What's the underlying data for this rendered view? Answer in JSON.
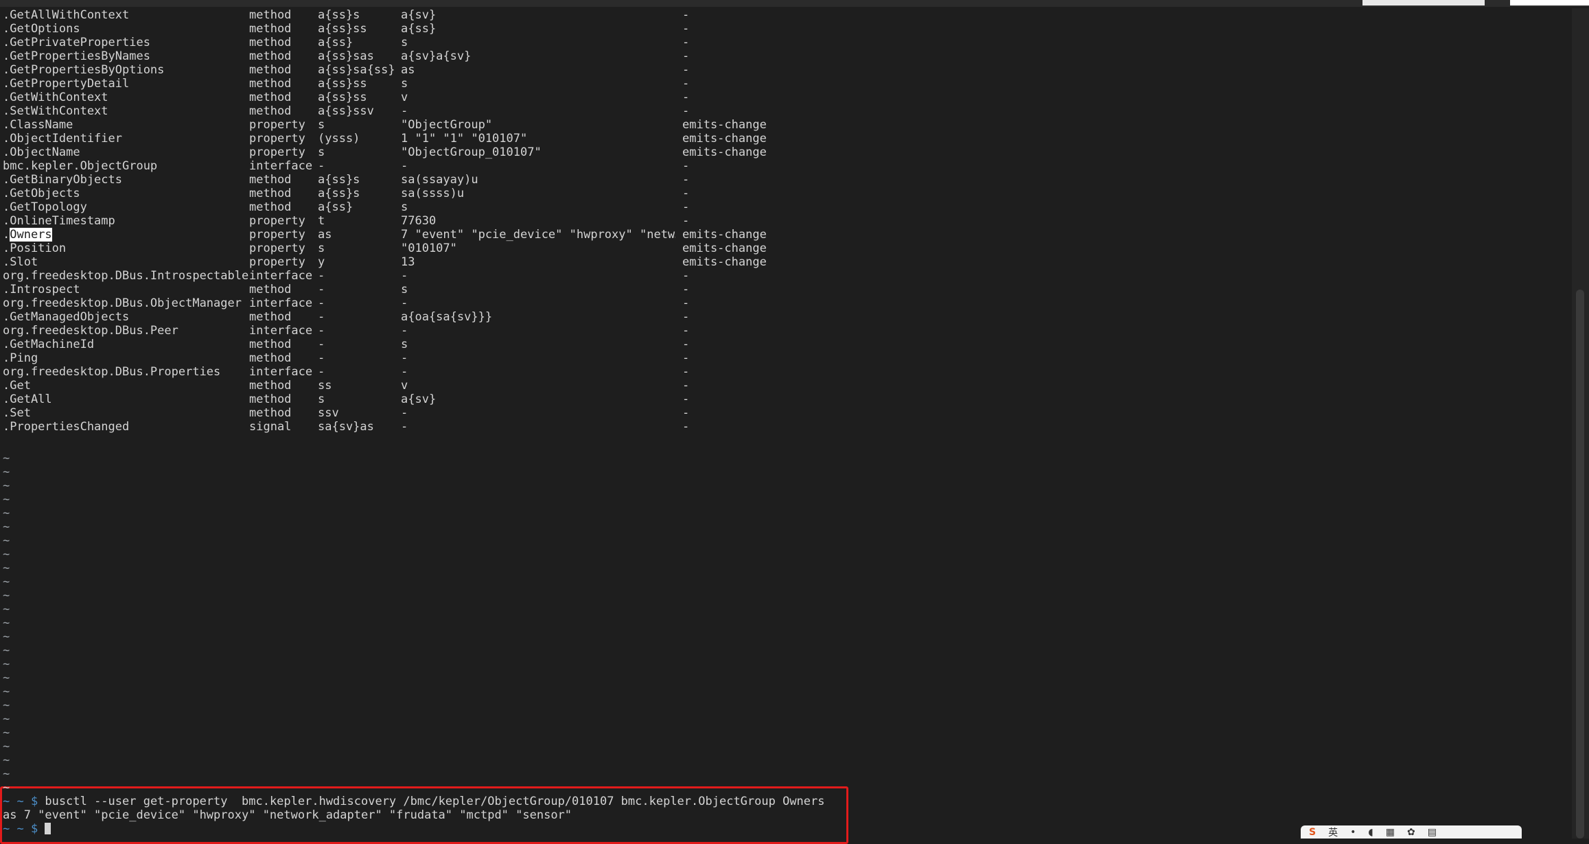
{
  "rows": [
    [
      ".GetAllWithContext",
      "method",
      "a{ss}s",
      "a{sv}",
      "-"
    ],
    [
      ".GetOptions",
      "method",
      "a{ss}ss",
      "a{ss}",
      "-"
    ],
    [
      ".GetPrivateProperties",
      "method",
      "a{ss}",
      "s",
      "-"
    ],
    [
      ".GetPropertiesByNames",
      "method",
      "a{ss}sas",
      "a{sv}a{sv}",
      "-"
    ],
    [
      ".GetPropertiesByOptions",
      "method",
      "a{ss}sa{ss}",
      "as",
      "-"
    ],
    [
      ".GetPropertyDetail",
      "method",
      "a{ss}ss",
      "s",
      "-"
    ],
    [
      ".GetWithContext",
      "method",
      "a{ss}ss",
      "v",
      "-"
    ],
    [
      ".SetWithContext",
      "method",
      "a{ss}ssv",
      "-",
      "-"
    ],
    [
      ".ClassName",
      "property",
      "s",
      "\"ObjectGroup\"",
      "emits-change"
    ],
    [
      ".ObjectIdentifier",
      "property",
      "(ysss)",
      "1 \"1\" \"1\" \"010107\"",
      "emits-change"
    ],
    [
      ".ObjectName",
      "property",
      "s",
      "\"ObjectGroup_010107\"",
      "emits-change"
    ],
    [
      "bmc.kepler.ObjectGroup",
      "interface",
      "-",
      "-",
      "-"
    ],
    [
      ".GetBinaryObjects",
      "method",
      "a{ss}s",
      "sa(ssayay)u",
      "-"
    ],
    [
      ".GetObjects",
      "method",
      "a{ss}s",
      "sa(ssss)u",
      "-"
    ],
    [
      ".GetTopology",
      "method",
      "a{ss}",
      "s",
      "-"
    ],
    [
      ".OnlineTimestamp",
      "property",
      "t",
      "77630",
      "-"
    ],
    [
      ".Owners",
      "property",
      "as",
      "7 \"event\" \"pcie_device\" \"hwproxy\" \"netw…",
      "emits-change"
    ],
    [
      ".Position",
      "property",
      "s",
      "\"010107\"",
      "emits-change"
    ],
    [
      ".Slot",
      "property",
      "y",
      "13",
      "emits-change"
    ],
    [
      "org.freedesktop.DBus.Introspectable",
      "interface",
      "-",
      "-",
      "-"
    ],
    [
      ".Introspect",
      "method",
      "-",
      "s",
      "-"
    ],
    [
      "org.freedesktop.DBus.ObjectManager",
      "interface",
      "-",
      "-",
      "-"
    ],
    [
      ".GetManagedObjects",
      "method",
      "-",
      "a{oa{sa{sv}}}",
      "-"
    ],
    [
      "org.freedesktop.DBus.Peer",
      "interface",
      "-",
      "-",
      "-"
    ],
    [
      ".GetMachineId",
      "method",
      "-",
      "s",
      "-"
    ],
    [
      ".Ping",
      "method",
      "-",
      "-",
      "-"
    ],
    [
      "org.freedesktop.DBus.Properties",
      "interface",
      "-",
      "-",
      "-"
    ],
    [
      ".Get",
      "method",
      "ss",
      "v",
      "-"
    ],
    [
      ".GetAll",
      "method",
      "s",
      "a{sv}",
      "-"
    ],
    [
      ".Set",
      "method",
      "ssv",
      "-",
      "-"
    ],
    [
      ".PropertiesChanged",
      "signal",
      "sa{sv}as",
      "-",
      "-"
    ]
  ],
  "highlight_row": 16,
  "highlight_text": "Owners",
  "tilde_char": "~",
  "tilde_count": 25,
  "command": {
    "line0": "~",
    "prompt": "~ ~ $",
    "text": " busctl --user get-property  bmc.kepler.hwdiscovery /bmc/kepler/ObjectGroup/010107 bmc.kepler.ObjectGroup Owners",
    "output": "as 7 \"event\" \"pcie_device\" \"hwproxy\" \"network_adapter\" \"frudata\" \"mctpd\" \"sensor\"",
    "prompt2": "~ ~ $"
  },
  "tray": {
    "ime": "英",
    "dot": "•"
  },
  "colors": {
    "background": "#1e1e1e",
    "text": "#d4d4d4",
    "prompt": "#4c8ec7",
    "box_border": "#e21b1b"
  }
}
